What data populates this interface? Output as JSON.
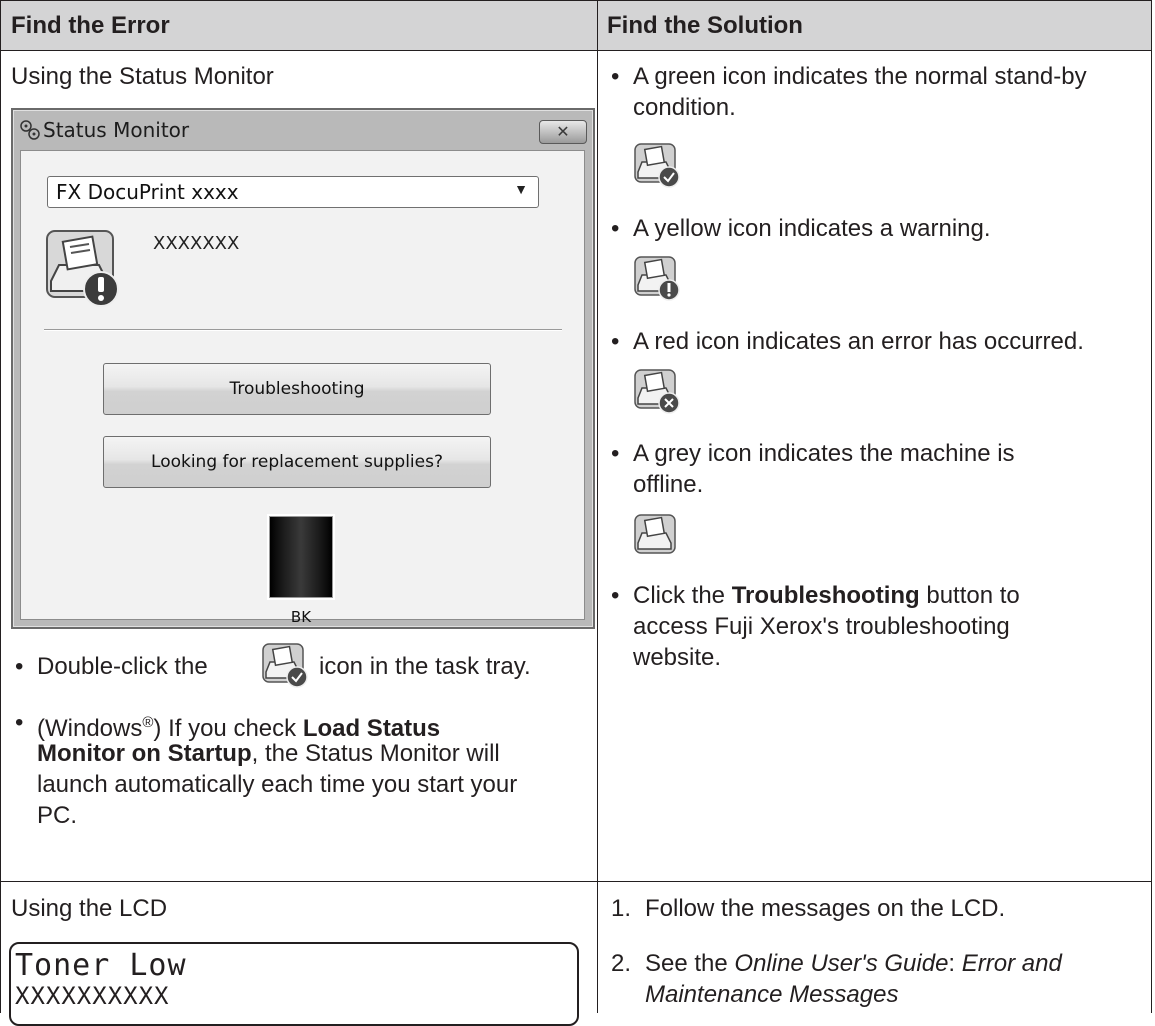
{
  "header": {
    "col1": "Find the Error",
    "col2": "Find the Solution"
  },
  "row1": {
    "left_title": "Using the Status Monitor",
    "status_monitor": {
      "window_title": "Status Monitor",
      "close_glyph": "✕",
      "printer_select_value": "FX DocuPrint xxxx",
      "status_text": "XXXXXXX",
      "troubleshooting_button": "Troubleshooting",
      "supplies_button": "Looking for replacement supplies?",
      "toner_label": "BK"
    },
    "left_bullets": {
      "b1_pre": "Double-click the",
      "b1_post": "icon in the task tray.",
      "b2_pre": "(Windows",
      "b2_reg": "®",
      "b2_mid": ") If you check ",
      "b2_bold1": "Load Status",
      "b2_bold2": "Monitor on Startup",
      "b2_after_bold": ", the Status Monitor will",
      "b2_l3": "launch automatically each time you start your",
      "b2_l4": "PC."
    },
    "right_bullets": {
      "green_l1": "A green icon indicates the normal stand-by",
      "green_l2": "condition.",
      "yellow": "A yellow icon indicates a warning.",
      "red": "A red icon indicates an error has occurred.",
      "grey_l1": "A grey icon indicates the machine is",
      "grey_l2": "offline.",
      "click_pre": "Click the ",
      "click_bold": "Troubleshooting",
      "click_post": " button to",
      "click_l2": "access Fuji Xerox's troubleshooting",
      "click_l3": "website."
    },
    "icons": {
      "green": "printer-ok-icon",
      "yellow": "printer-warning-icon",
      "red": "printer-error-icon",
      "grey": "printer-offline-icon"
    }
  },
  "row2": {
    "left_title": "Using the LCD",
    "lcd_line1": "Toner Low",
    "lcd_line2": "XXXXXXXXXX",
    "steps": {
      "s1_num": "1.",
      "s1": "Follow the messages on the LCD.",
      "s2_num": "2.",
      "s2_pre": "See the ",
      "s2_italic1": "Online User's Guide",
      "s2_colon": ": ",
      "s2_italic2": "Error and",
      "s2_l2": "Maintenance Messages"
    }
  }
}
